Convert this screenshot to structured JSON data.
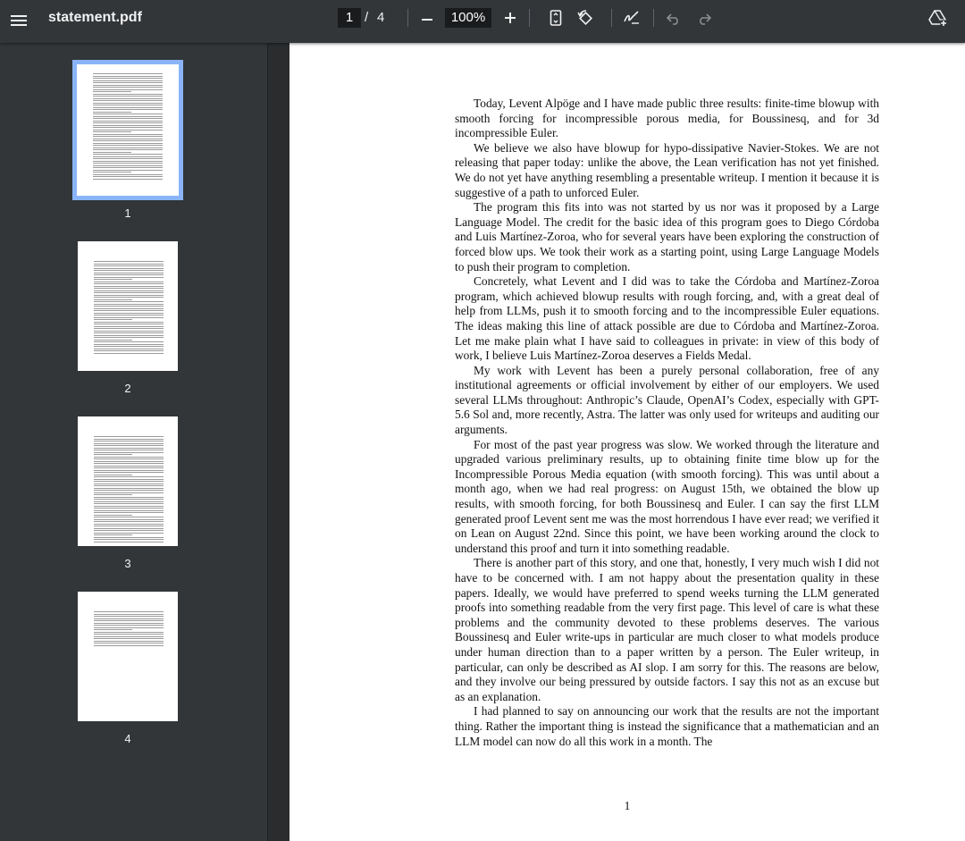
{
  "toolbar": {
    "filename": "statement.pdf",
    "current_page": "1",
    "page_separator": "/",
    "total_pages": "4",
    "zoom": "100%"
  },
  "sidebar": {
    "thumbnails": [
      {
        "label": "1"
      },
      {
        "label": "2"
      },
      {
        "label": "3"
      },
      {
        "label": "4"
      }
    ]
  },
  "document": {
    "paragraphs": [
      "Today, Levent Alpöge and I have made public three results: finite-time blowup with smooth forcing for incompressible porous media, for Boussinesq, and for 3d incompressible Euler.",
      "We believe we also have blowup for hypo-dissipative Navier-Stokes. We are not releasing that paper today: unlike the above, the Lean verification has not yet finished. We do not yet have anything resembling a presentable writeup. I mention it because it is suggestive of a path to unforced Euler.",
      "The program this fits into was not started by us nor was it proposed by a Large Language Model. The credit for the basic idea of this program goes to Diego Córdoba and Luis Martínez-Zoroa, who for several years have been exploring the construction of forced blow ups. We took their work as a starting point, using Large Language Models to push their program to completion.",
      "Concretely, what Levent and I did was to take the Córdoba and Martínez-Zoroa program, which achieved blowup results with rough forcing, and, with a great deal of help from LLMs, push it to smooth forcing and to the incompressible Euler equations. The ideas making this line of attack possible are due to Córdoba and Martínez-Zoroa. Let me make plain what I have said to colleagues in private: in view of this body of work, I believe Luis Martínez-Zoroa deserves a Fields Medal.",
      "My work with Levent has been a purely personal collaboration, free of any institutional agreements or official involvement by either of our employers. We used several LLMs throughout: Anthropic’s Claude, OpenAI’s Codex, especially with GPT-5.6 Sol and, more recently, Astra. The latter was only used for writeups and auditing our arguments.",
      "For most of the past year progress was slow. We worked through the literature and upgraded various preliminary results, up to obtaining finite time blow up for the Incompressible Porous Media equation (with smooth forcing). This was until about a month ago, when we had real progress: on August 15th, we obtained the blow up results, with smooth forcing, for both Boussinesq and Euler. I can say the first LLM generated proof Levent sent me was the most horrendous I have ever read; we verified it on Lean on August 22nd. Since this point, we have been working around the clock to understand this proof and turn it into something readable.",
      "There is another part of this story, and one that, honestly, I very much wish I did not have to be concerned with. I am not happy about the presentation quality in these papers. Ideally, we would have preferred to spend weeks turning the LLM generated proofs into something readable from the very first page. This level of care is what these problems and the community devoted to these problems deserves. The various Boussinesq and Euler write-ups in particular are much closer to what models produce under human direction than to a paper written by a person. The Euler writeup, in particular, can only be described as AI slop. I am sorry for this. The reasons are below, and they involve our being pressured by outside factors. I say this not as an excuse but as an explanation.",
      "I had planned to say on announcing our work that the results are not the important thing. Rather the important thing is instead the significance that a mathematician and an LLM model can now do all this work in a month. The"
    ],
    "page_number": "1"
  },
  "colors": {
    "toolbar_bg": "#323639",
    "sidebar_bg": "#323639",
    "selected_thumbnail_outline": "#8ab4f8",
    "page_bg": "#ffffff"
  }
}
